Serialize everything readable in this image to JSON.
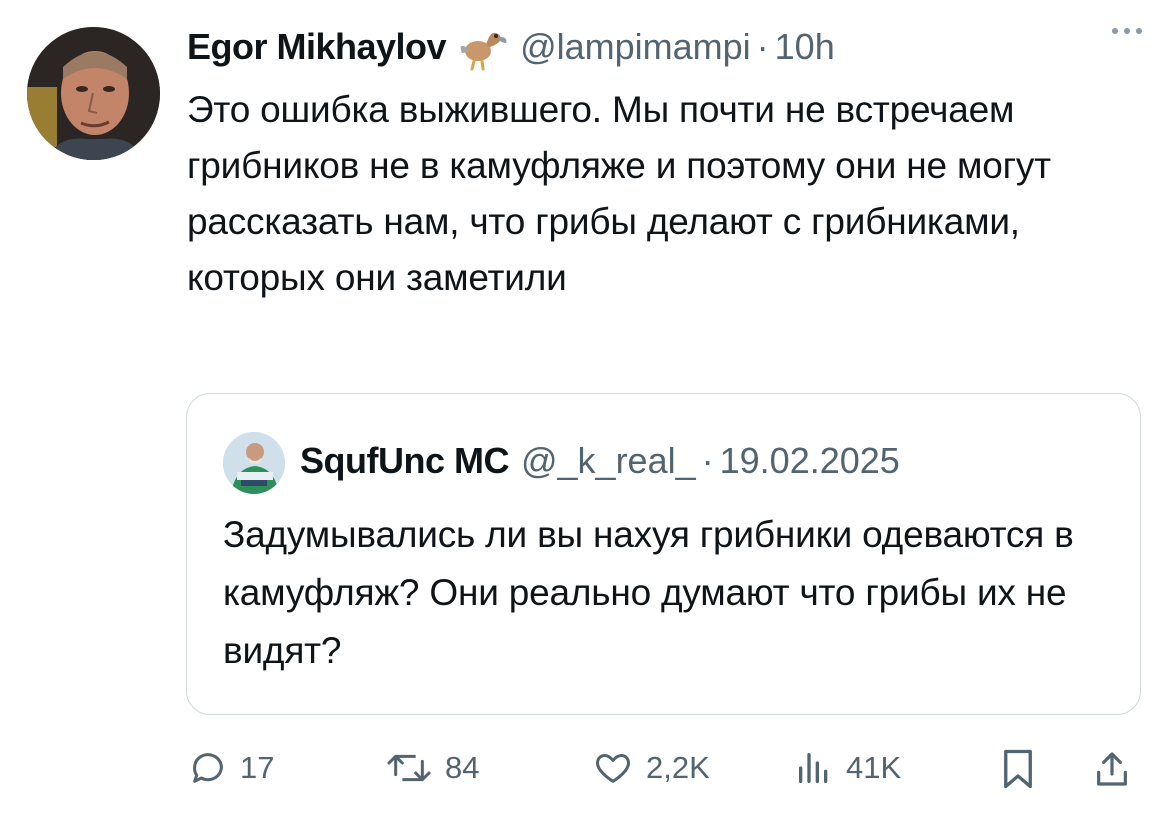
{
  "author": {
    "name": "Egor Mikhaylov",
    "handle": "@lampimampi",
    "time": "10h",
    "badge_icon": "dodo-bird-icon"
  },
  "tweet": {
    "text": "Это ошибка выжившего. Мы почти не встречаем грибников не в камуфляже и поэтому они не могут рассказать нам, что грибы делают с грибниками, которых они заметили"
  },
  "quoted": {
    "name": "SqufUnc MC",
    "handle": "@_k_real_",
    "date": "19.02.2025",
    "text": "Задумывались ли вы нахуя грибники одеваются в камуфляж? Они реально думают что грибы их не видят?"
  },
  "actions": {
    "replies": "17",
    "reposts": "84",
    "likes": "2,2K",
    "views": "41K"
  },
  "colors": {
    "text": "#0f1419",
    "secondary": "#536471",
    "border": "#cfd9de"
  }
}
